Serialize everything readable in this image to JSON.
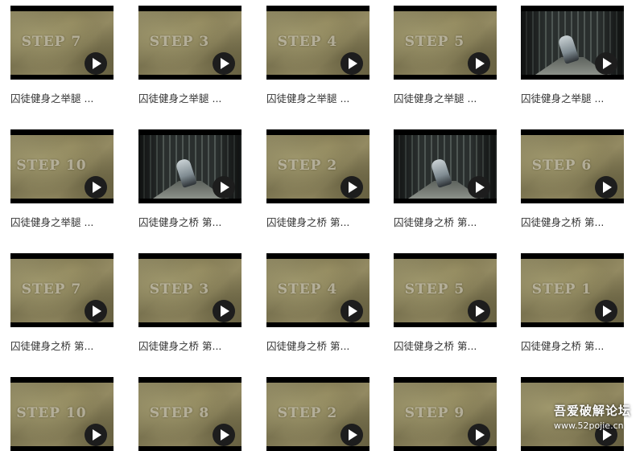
{
  "videos": [
    {
      "title": "囚徒健身之举腿 ...",
      "thumb_text": "STEP 7",
      "scene": "plaster"
    },
    {
      "title": "囚徒健身之举腿 ...",
      "thumb_text": "STEP 3",
      "scene": "plaster"
    },
    {
      "title": "囚徒健身之举腿 ...",
      "thumb_text": "STEP 4",
      "scene": "plaster"
    },
    {
      "title": "囚徒健身之举腿 ...",
      "thumb_text": "STEP 5",
      "scene": "plaster"
    },
    {
      "title": "囚徒健身之举腿 ...",
      "thumb_text": "",
      "scene": "corridor"
    },
    {
      "title": "囚徒健身之举腿 ...",
      "thumb_text": "STEP 10",
      "scene": "plaster"
    },
    {
      "title": "囚徒健身之桥 第...",
      "thumb_text": "",
      "scene": "corridor"
    },
    {
      "title": "囚徒健身之桥 第...",
      "thumb_text": "STEP 2",
      "scene": "plaster"
    },
    {
      "title": "囚徒健身之桥 第...",
      "thumb_text": "",
      "scene": "corridor"
    },
    {
      "title": "囚徒健身之桥 第...",
      "thumb_text": "STEP 6",
      "scene": "plaster"
    },
    {
      "title": "囚徒健身之桥 第...",
      "thumb_text": "STEP 7",
      "scene": "plaster"
    },
    {
      "title": "囚徒健身之桥 第...",
      "thumb_text": "STEP 3",
      "scene": "plaster"
    },
    {
      "title": "囚徒健身之桥 第...",
      "thumb_text": "STEP 4",
      "scene": "plaster"
    },
    {
      "title": "囚徒健身之桥 第...",
      "thumb_text": "STEP 5",
      "scene": "plaster"
    },
    {
      "title": "囚徒健身之桥 第...",
      "thumb_text": "STEP 1",
      "scene": "plaster"
    },
    {
      "title": "",
      "thumb_text": "STEP 10",
      "scene": "plaster"
    },
    {
      "title": "",
      "thumb_text": "STEP 8",
      "scene": "plaster"
    },
    {
      "title": "",
      "thumb_text": "STEP 2",
      "scene": "plaster"
    },
    {
      "title": "",
      "thumb_text": "STEP 9",
      "scene": "plaster"
    },
    {
      "title": "",
      "thumb_text": "",
      "scene": "plaster"
    }
  ],
  "watermark": {
    "line1": "吾爱破解论坛",
    "line2": "www.52pojie.cn"
  },
  "icons": {
    "play": "play-icon"
  },
  "colors": {
    "caption": "#333333",
    "play_bg": "#1d1d1d",
    "letterbox": "#000000"
  }
}
